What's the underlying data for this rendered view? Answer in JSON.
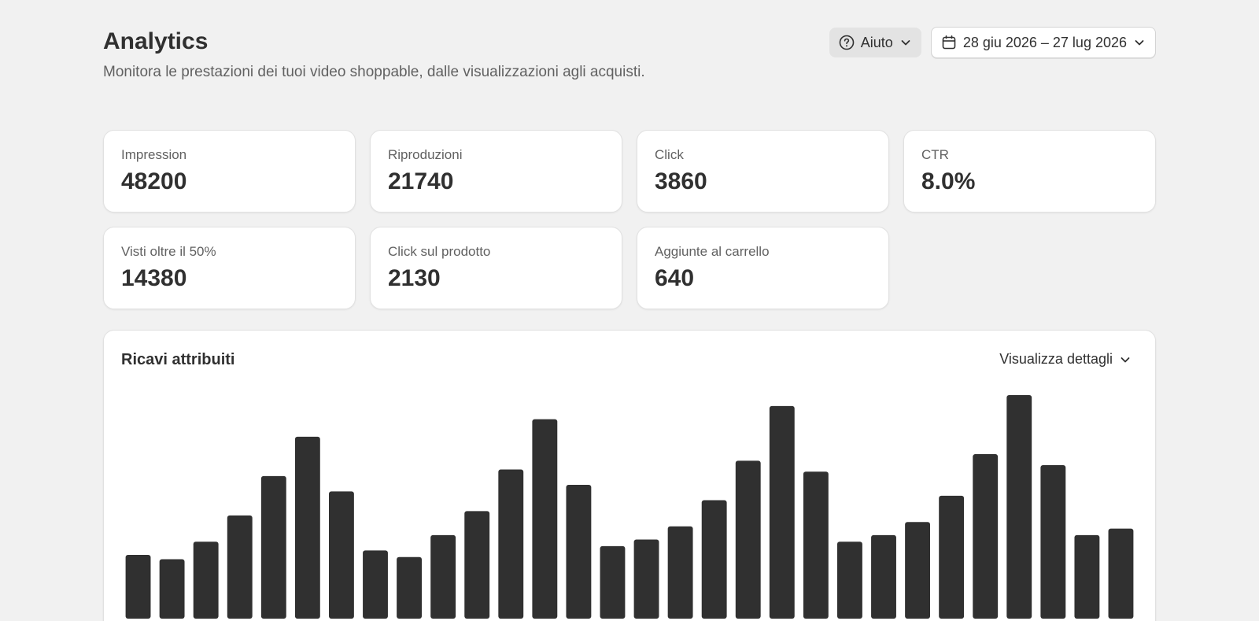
{
  "header": {
    "title": "Analytics",
    "subtitle": "Monitora le prestazioni dei tuoi video shoppable, dalle visualizzazioni agli acquisti.",
    "help_label": "Aiuto",
    "help_icon": "help-circle-icon",
    "date_range": "28 giu 2026 – 27 lug 2026",
    "date_icon": "calendar-icon"
  },
  "metrics": [
    {
      "label": "Impression",
      "value": "48200"
    },
    {
      "label": "Riproduzioni",
      "value": "21740"
    },
    {
      "label": "Click",
      "value": "3860"
    },
    {
      "label": "CTR",
      "value": "8.0%"
    },
    {
      "label": "Visti oltre il 50%",
      "value": "14380"
    },
    {
      "label": "Click sul prodotto",
      "value": "2130"
    },
    {
      "label": "Aggiunte al carrello",
      "value": "640"
    }
  ],
  "revenue": {
    "title": "Ricavi attribuiti",
    "details_label": "Visualizza dettagli"
  },
  "colors": {
    "bar": "#303030",
    "background": "#f1f1f1",
    "card": "#ffffff"
  },
  "chart_data": {
    "type": "bar",
    "title": "Ricavi attribuiti",
    "xlabel": "",
    "ylabel": "",
    "grid": false,
    "ylim": [
      0,
      100
    ],
    "values": [
      27,
      25,
      33,
      45,
      63,
      81,
      56,
      29,
      26,
      36,
      47,
      66,
      89,
      59,
      31,
      34,
      40,
      52,
      70,
      95,
      65,
      33,
      36,
      42,
      54,
      73,
      100,
      68,
      36,
      39
    ]
  }
}
